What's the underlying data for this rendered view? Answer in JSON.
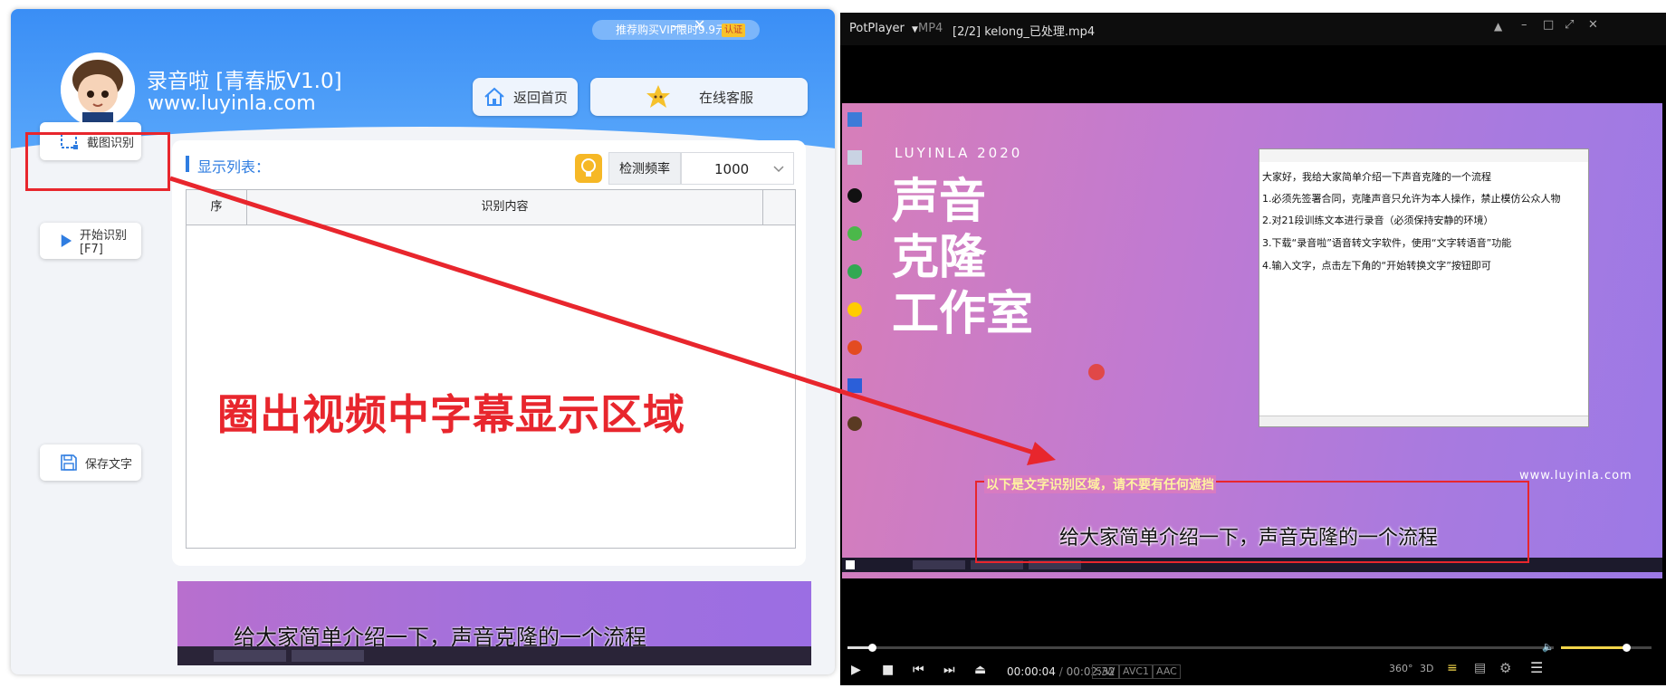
{
  "app": {
    "vip_text": "推荐购买VIP限时9.9元",
    "vip_badge": "认证",
    "minimize": "—",
    "close": "✕",
    "title": "录音啦 [青春版V1.0]",
    "url": "www.luyinla.com",
    "home_label": "返回首页",
    "service_label": "在线客服",
    "side": {
      "capture_label": "截图识别",
      "start_label": "开始识别[F7]",
      "save_label": "保存文字"
    },
    "list_label": "显示列表：",
    "freq_label": "检测频率",
    "freq_value": "1000",
    "table_headers": [
      "序",
      "识别内容"
    ],
    "preview_subtitle": "给大家简单介绍一下，声音克隆的一个流程"
  },
  "annotation": {
    "text": "圈出视频中字幕显示区域"
  },
  "player": {
    "app_name": "PotPlayer",
    "format": "MP4",
    "file_title": "[2/2] kelong_已处理.mp4",
    "time_current": "00:00:04",
    "time_separator": "/",
    "time_total": "00:02:32",
    "tags": [
      "S/W",
      "AVC1",
      "AAC"
    ],
    "seek_progress": 0.034,
    "volume_level": 0.72,
    "video": {
      "brand": "LUYINLA 2020",
      "headline": [
        "声音",
        "克隆",
        "工作室"
      ],
      "watermark": "www.luyinla.com",
      "notepad_lines": [
        "大家好，我给大家简单介绍一下声音克隆的一个流程",
        "1.必须先签署合同，克隆声音只允许为本人操作，禁止模仿公众人物",
        "2.对21段训练文本进行录音（必须保持安静的环境）",
        "3.下载“录音啦”语音转文字软件，使用“文字转语音”功能",
        "4.输入文字，点击左下角的“开始转换文字”按钮即可"
      ],
      "region_label": "以下是文字识别区域，请不要有任何遮挡",
      "subtitle": "给大家简单介绍一下，声音克隆的一个流程"
    }
  },
  "colors": {
    "accent_blue": "#3a8ef5",
    "annotation_red": "#e8262d",
    "player_bg": "#000000"
  }
}
